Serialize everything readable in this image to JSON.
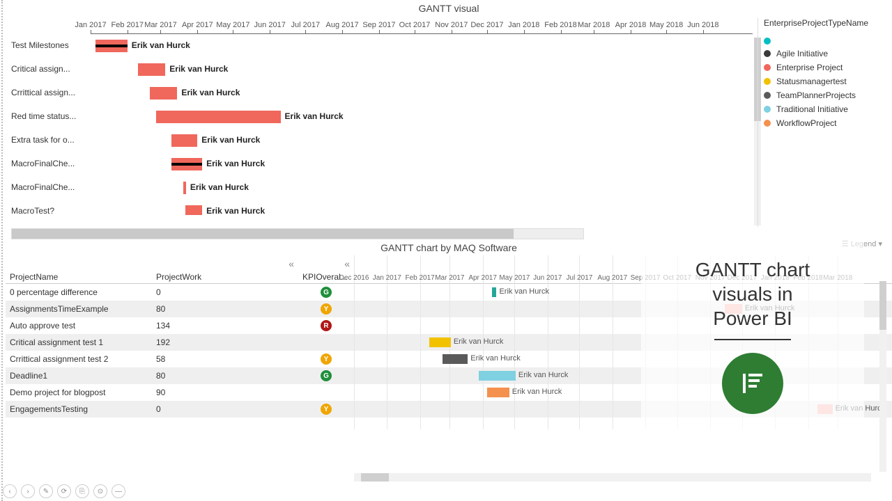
{
  "chart_data": [
    {
      "type": "gantt",
      "title": "GANTT visual",
      "x_range": [
        "2017-01-01",
        "2018-07-01"
      ],
      "x_ticks": [
        "Jan 2017",
        "Feb 2017",
        "Mar 2017",
        "Apr 2017",
        "May 2017",
        "Jun 2017",
        "Jul 2017",
        "Aug 2017",
        "Sep 2017",
        "Oct 2017",
        "Nov 2017",
        "Dec 2017",
        "Jan 2018",
        "Feb 2018",
        "Mar 2018",
        "Apr 2018",
        "May 2018",
        "Jun 2018"
      ],
      "tasks": [
        {
          "name": "Test Milestones",
          "assignee": "Erik van Hurck",
          "start": "2017-01-05",
          "end": "2017-02-01",
          "color": "#f0675c",
          "progress_marker": true
        },
        {
          "name": "Critical assign...",
          "assignee": "Erik van Hurck",
          "start": "2017-02-10",
          "end": "2017-03-05",
          "color": "#f0675c"
        },
        {
          "name": "Crrittical assign...",
          "assignee": "Erik van Hurck",
          "start": "2017-02-20",
          "end": "2017-03-15",
          "color": "#f0675c"
        },
        {
          "name": "Red time status...",
          "assignee": "Erik van Hurck",
          "start": "2017-02-25",
          "end": "2017-06-10",
          "color": "#f0675c"
        },
        {
          "name": "Extra task for o...",
          "assignee": "Erik van Hurck",
          "start": "2017-03-10",
          "end": "2017-04-01",
          "color": "#f0675c"
        },
        {
          "name": "MacroFinalChe...",
          "assignee": "Erik van Hurck",
          "start": "2017-03-10",
          "end": "2017-04-05",
          "color": "#f0675c",
          "progress_marker": true
        },
        {
          "name": "MacroFinalChe...",
          "assignee": "Erik van Hurck",
          "start": "2017-03-20",
          "end": "2017-03-22",
          "color": "#f0675c"
        },
        {
          "name": "MacroTest?",
          "assignee": "Erik van Hurck",
          "start": "2017-03-22",
          "end": "2017-04-05",
          "color": "#f0675c"
        }
      ],
      "legend_title": "EnterpriseProjectTypeName",
      "legend": [
        {
          "label": "",
          "color": "#00bfc4"
        },
        {
          "label": "Agile Initiative",
          "color": "#3a3a3a"
        },
        {
          "label": "Enterprise Project",
          "color": "#f0675c"
        },
        {
          "label": "Statusmanagertest",
          "color": "#f2c200"
        },
        {
          "label": "TeamPlannerProjects",
          "color": "#5a5a5a"
        },
        {
          "label": "Traditional Initiative",
          "color": "#7fd0e1"
        },
        {
          "label": "WorkflowProject",
          "color": "#f4914e"
        }
      ]
    },
    {
      "type": "gantt-table",
      "title": "GANTT chart by MAQ Software",
      "columns": [
        "ProjectName",
        "ProjectWork",
        "KPIOveral..."
      ],
      "x_range": [
        "2016-12-01",
        "2018-03-31"
      ],
      "x_ticks": [
        "Dec 2016",
        "Jan 2017",
        "Feb 2017",
        "Mar 2017",
        "Apr 2017",
        "May 2017",
        "Jun 2017",
        "Jul 2017",
        "Aug 2017",
        "Sep 2017",
        "Oct 2017",
        "Nov 2017",
        "Dec 2017",
        "Jan 2018",
        "Feb 2018",
        "Mar 2018"
      ],
      "rows": [
        {
          "ProjectName": "0 percentage difference",
          "ProjectWork": 0,
          "KPI": "G",
          "bar": {
            "start": "2017-04-10",
            "end": "2017-04-14",
            "color": "#26a69a"
          },
          "assignee": "Erik van Hurck"
        },
        {
          "ProjectName": "AssignmentsTimeExample",
          "ProjectWork": 80,
          "KPI": "Y",
          "bar": {
            "start": "2017-11-15",
            "end": "2017-12-01",
            "color": "#f8b8b1"
          },
          "assignee": "Erik van Hurck"
        },
        {
          "ProjectName": "Auto approve test",
          "ProjectWork": 134,
          "KPI": "R"
        },
        {
          "ProjectName": "Critical assignment test 1",
          "ProjectWork": 192,
          "KPI": "",
          "bar": {
            "start": "2017-02-10",
            "end": "2017-03-02",
            "color": "#f2c200"
          },
          "assignee": "Erik van Hurck"
        },
        {
          "ProjectName": "Crrittical assignment test 2",
          "ProjectWork": 58,
          "KPI": "Y",
          "bar": {
            "start": "2017-02-22",
            "end": "2017-03-18",
            "color": "#5a5a5a"
          },
          "assignee": "Erik van Hurck"
        },
        {
          "ProjectName": "Deadline1",
          "ProjectWork": 80,
          "KPI": "G",
          "bar": {
            "start": "2017-03-28",
            "end": "2017-05-02",
            "color": "#7fd0e1"
          },
          "assignee": "Erik van Hurck"
        },
        {
          "ProjectName": "Demo project for blogpost",
          "ProjectWork": 90,
          "KPI": "",
          "bar": {
            "start": "2017-04-05",
            "end": "2017-04-26",
            "color": "#f4914e"
          },
          "assignee": "Erik van Hurck"
        },
        {
          "ProjectName": "EngagementsTesting",
          "ProjectWork": 0,
          "KPI": "Y",
          "bar": {
            "start": "2018-02-10",
            "end": "2018-02-24",
            "color": "#f8b8b1"
          },
          "assignee": "Erik van Hurck"
        }
      ],
      "legend_button": "Legend"
    }
  ],
  "overlay": {
    "line1": "GANTT chart",
    "line2": "visuals in",
    "line3": "Power BI"
  },
  "toolbar": [
    "‹",
    "›",
    "✎",
    "⟳",
    "⎘",
    "⊙",
    "—"
  ]
}
